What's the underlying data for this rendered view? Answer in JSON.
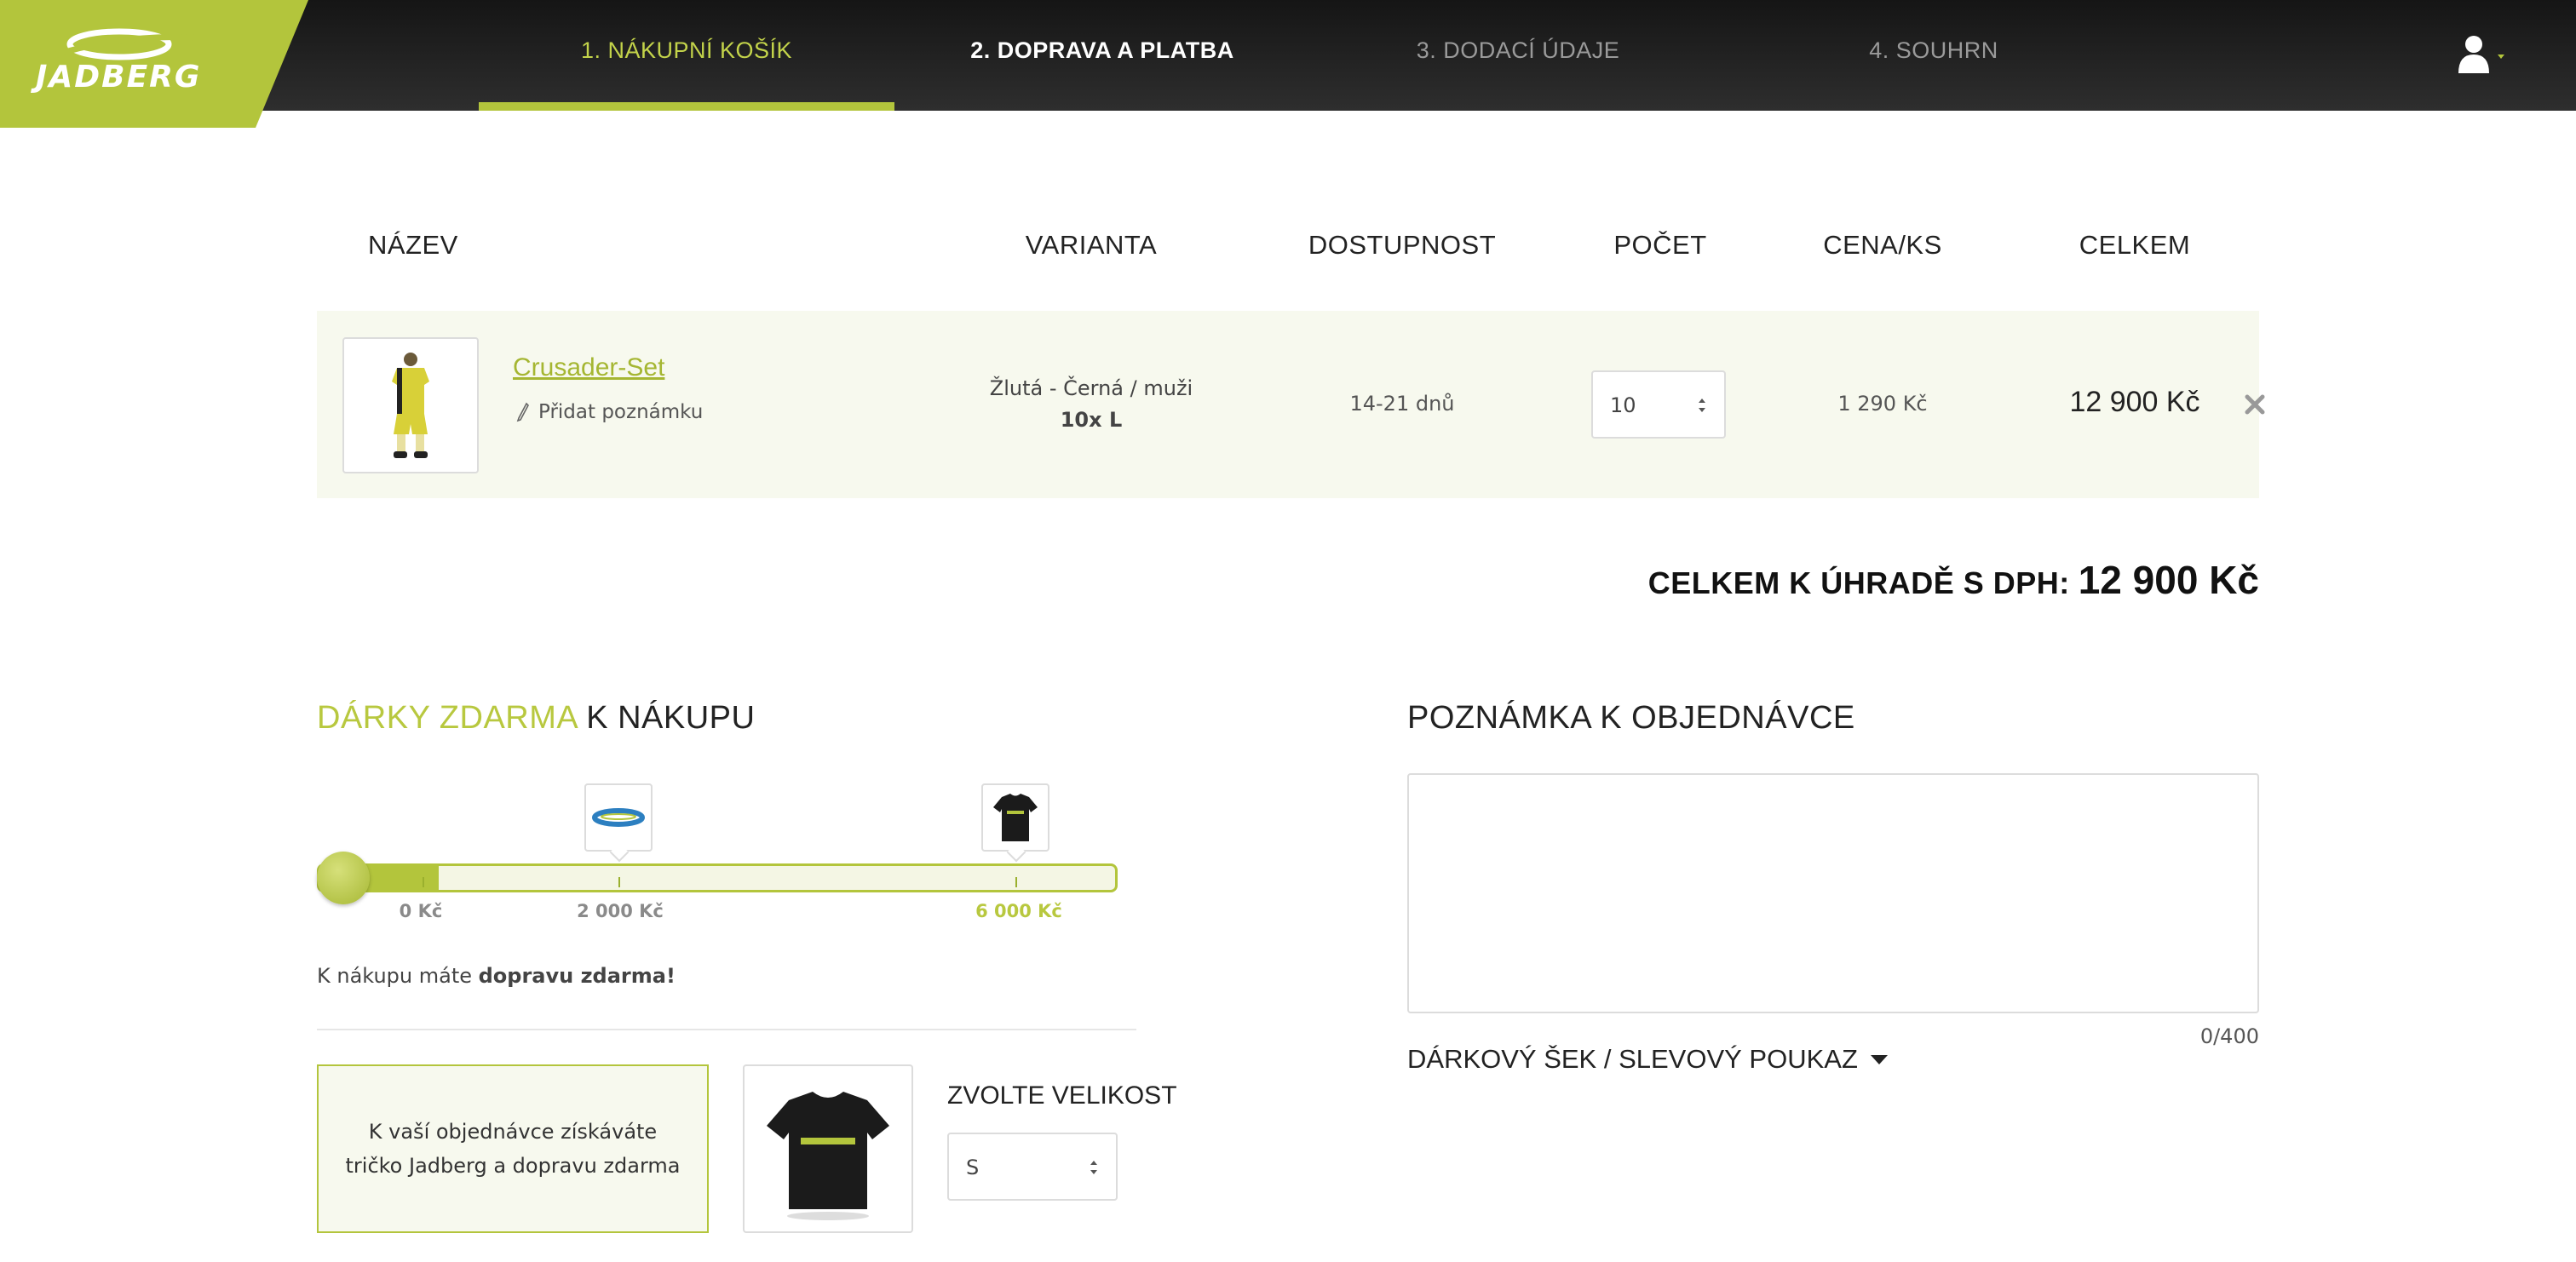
{
  "brand": {
    "logo_text": "JADBERG",
    "accent_color": "#b3c53c"
  },
  "steps": [
    {
      "label": "1. NÁKUPNÍ KOŠÍK",
      "state": "active"
    },
    {
      "label": "2. DOPRAVA A PLATBA",
      "state": "next"
    },
    {
      "label": "3. DODACÍ ÚDAJE",
      "state": "inactive"
    },
    {
      "label": "4. SOUHRN",
      "state": "inactive"
    }
  ],
  "user_menu": {
    "icon": "user-icon"
  },
  "cart_table": {
    "headers": {
      "name": "NÁZEV",
      "variant": "VARIANTA",
      "availability": "DOSTUPNOST",
      "quantity": "POČET",
      "unit_price": "CENA/KS",
      "total": "CELKEM"
    },
    "rows": [
      {
        "name": "Crusader-Set",
        "add_note": "Přidat poznámku",
        "variant_color": "Žlutá - Černá / muži",
        "variant_size": "10x L",
        "availability": "14-21 dnů",
        "quantity": "10",
        "unit_price": "1 290 Kč",
        "total": "12 900 Kč"
      }
    ]
  },
  "grand_total": {
    "label": "CELKEM K ÚHRADĚ S DPH:",
    "value": "12 900 Kč"
  },
  "gifts": {
    "title_accent": "DÁRKY ZDARMA",
    "title_rest": " K NÁKUPU",
    "progress_fraction": 0.15,
    "thresholds": [
      "0 Kč",
      "2 000 Kč",
      "6 000 Kč"
    ],
    "free_shipping_prefix": "K nákupu máte ",
    "free_shipping_bold": "dopravu zdarma!",
    "info_text": "K vaší objednávce získáváte tričko Jadberg a dopravu zdarma",
    "size_label": "ZVOLTE VELIKOST",
    "size_value": "S"
  },
  "order_note": {
    "title": "POZNÁMKA K OBJEDNÁVCE",
    "value": "",
    "counter": "0/400",
    "voucher_toggle": "DÁRKOVÝ ŠEK / SLEVOVÝ POUKAZ"
  }
}
